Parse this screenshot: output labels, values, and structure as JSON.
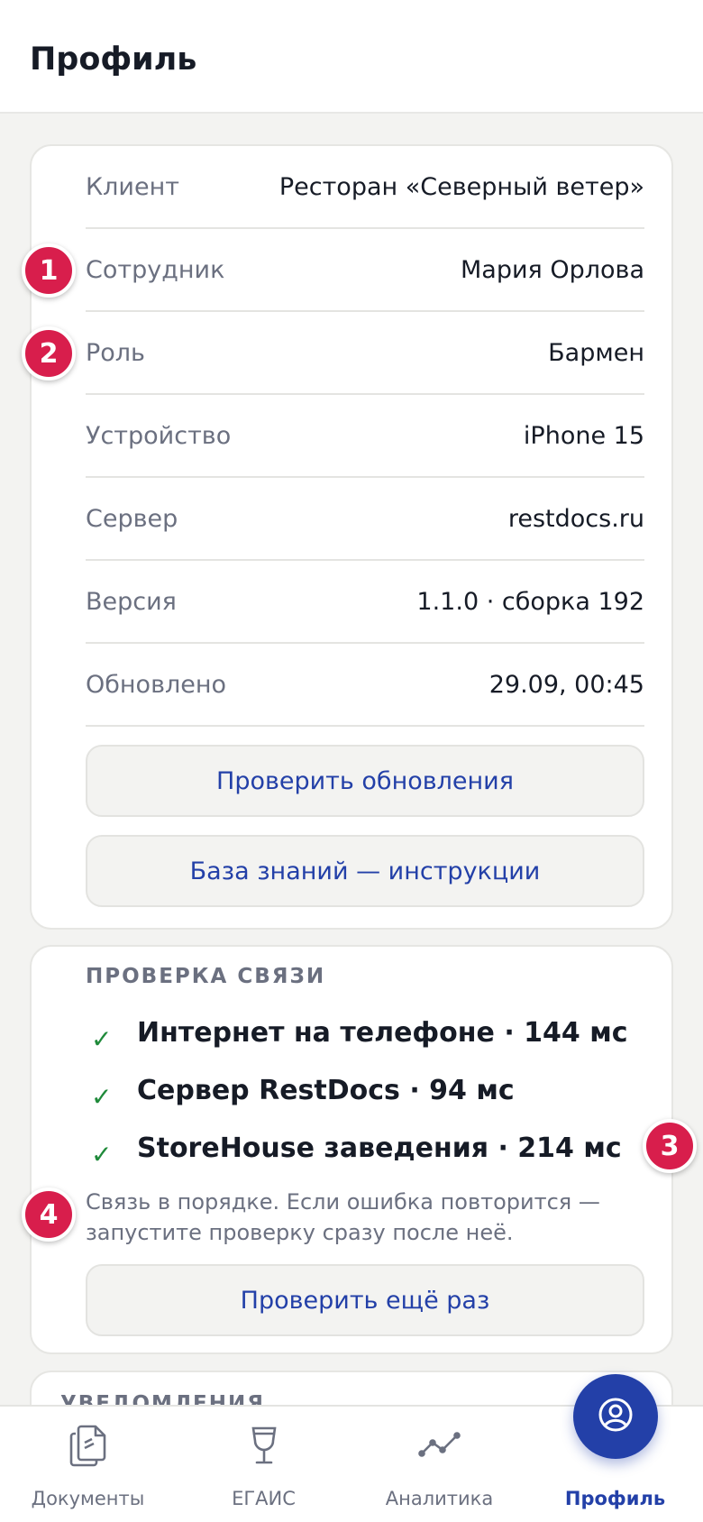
{
  "header": {
    "title": "Профиль"
  },
  "info": {
    "rows": [
      {
        "label": "Клиент",
        "value": "Ресторан «Северный ветер»"
      },
      {
        "label": "Сотрудник",
        "value": "Мария Орлова"
      },
      {
        "label": "Роль",
        "value": "Бармен"
      },
      {
        "label": "Устройство",
        "value": "iPhone 15"
      },
      {
        "label": "Сервер",
        "value": "restdocs.ru"
      },
      {
        "label": "Версия",
        "value": "1.1.0 · сборка 192"
      },
      {
        "label": "Обновлено",
        "value": "29.09, 00:45"
      }
    ],
    "check_updates_label": "Проверить обновления",
    "knowledge_base_label": "База знаний — инструкции"
  },
  "connection": {
    "title": "ПРОВЕРКА СВЯЗИ",
    "checks": [
      {
        "mark": "✓",
        "text": "Интернет на телефоне · 144 мс"
      },
      {
        "mark": "✓",
        "text": "Сервер RestDocs · 94 мс"
      },
      {
        "mark": "✓",
        "text": "StoreHouse заведения · 214 мс"
      }
    ],
    "note": "Связь в порядке. Если ошибка повторится — запустите проверку сразу после неё.",
    "recheck_label": "Проверить ещё раз"
  },
  "notifications": {
    "title": "УВЕДОМЛЕНИЯ"
  },
  "badges": [
    "1",
    "2",
    "3",
    "4"
  ],
  "tabbar": {
    "tabs": [
      {
        "label": "Документы",
        "icon": "documents-icon"
      },
      {
        "label": "ЕГАИС",
        "icon": "wine-glass-icon"
      },
      {
        "label": "Аналитика",
        "icon": "analytics-icon"
      },
      {
        "label": "Профиль",
        "icon": "profile-icon"
      }
    ],
    "active": "Профиль"
  },
  "colors": {
    "accent": "#2340a8",
    "badge": "#d81e4c",
    "success": "#1f8a3a",
    "background": "#f3f3f1"
  }
}
